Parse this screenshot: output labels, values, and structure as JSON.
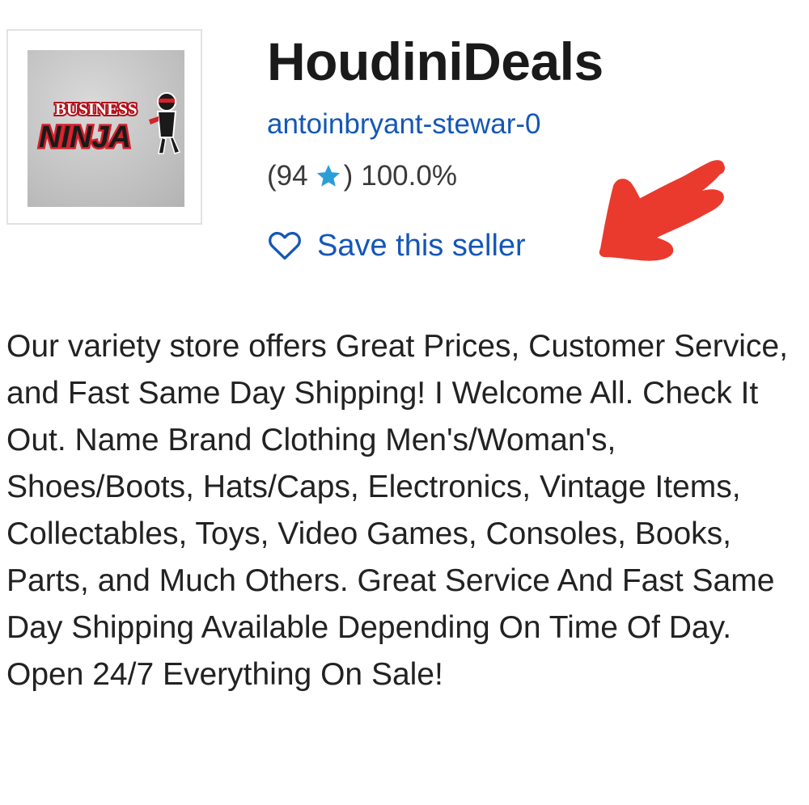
{
  "store": {
    "name": "HoudiniDeals",
    "seller_id": "antoinbryant-stewar-0",
    "feedback_open": "(94",
    "feedback_close": ")",
    "positive_percent": "100.0%",
    "save_label": "Save this seller",
    "logo_text_top": "BUSINESS",
    "logo_text_bottom": "NINJA",
    "logo_icon": "ninja-logo-icon",
    "star_icon": "star-icon",
    "heart_icon": "heart-outline-icon"
  },
  "description": "Our variety store offers Great Prices, Customer Service, and Fast Same Day Shipping! I Welcome All. Check It Out. Name Brand Clothing Men's/Woman's, Shoes/Boots, Hats/Caps, Electronics, Vintage Items, Collectables, Toys, Video Games, Consoles, Books, Parts, and Much Others. Great Service And Fast Same Day Shipping Available Depending On Time Of Day. Open 24/7 Everything On Sale!",
  "colors": {
    "link": "#1457b8",
    "star": "#2a9fd6",
    "annotation": "#ea3a2e",
    "logo_red": "#d6202a"
  }
}
